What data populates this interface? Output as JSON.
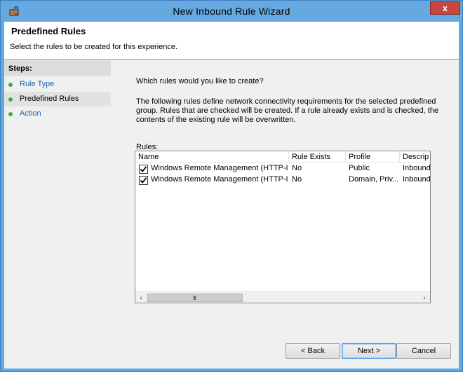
{
  "window": {
    "title": "New Inbound Rule Wizard",
    "close_label": "x"
  },
  "header": {
    "title": "Predefined Rules",
    "subtitle": "Select the rules to be created for this experience."
  },
  "steps": {
    "title": "Steps:",
    "items": [
      {
        "label": "Rule Type",
        "active": false
      },
      {
        "label": "Predefined Rules",
        "active": true
      },
      {
        "label": "Action",
        "active": false
      }
    ]
  },
  "main": {
    "question": "Which rules would you like to create?",
    "description": "The following rules define network connectivity requirements for the selected predefined group. Rules that are checked will be created. If a rule already exists and is checked, the contents of the existing rule will be overwritten.",
    "rules_label": "Rules:"
  },
  "rules_table": {
    "columns": [
      "Name",
      "Rule Exists",
      "Profile",
      "Descrip"
    ],
    "rows": [
      {
        "checked": true,
        "name": "Windows Remote Management (HTTP-In)",
        "rule_exists": "No",
        "profile": "Public",
        "description": "Inbound"
      },
      {
        "checked": true,
        "name": "Windows Remote Management (HTTP-In)",
        "rule_exists": "No",
        "profile": "Domain, Priv...",
        "description": "Inbound"
      }
    ],
    "scroll_grip": "III"
  },
  "buttons": {
    "back": "< Back",
    "next": "Next >",
    "cancel": "Cancel"
  },
  "colors": {
    "titlebar": "#66a8e0",
    "close": "#c7463d",
    "step_dot": "#3fae3f",
    "link": "#1a5fb4"
  }
}
